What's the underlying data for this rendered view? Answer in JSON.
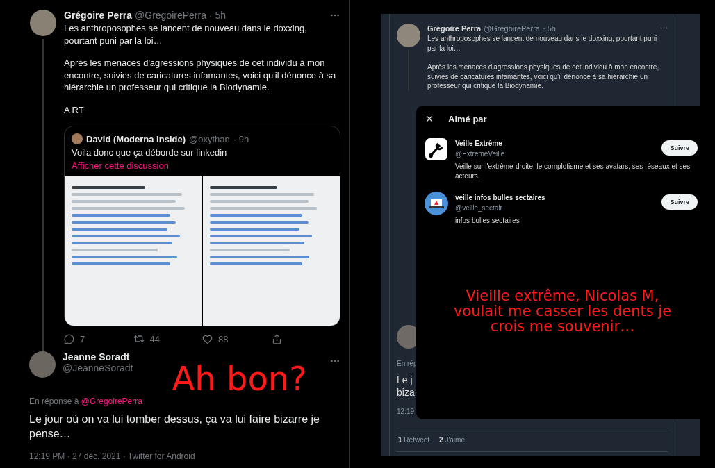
{
  "left_thread": {
    "tweet": {
      "name": "Grégoire Perra",
      "handle": "@GregoirePerra",
      "time": "· 5h",
      "paragraphs": [
        "Les anthroposophes se lancent de nouveau dans le doxxing, pourtant puni par la loi…",
        "Après les menaces d'agressions physiques de cet individu à mon encontre, suivies de caricatures infamantes, voici qu'il dénonce à sa hiérarchie un professeur qui critique la Biodynamie.",
        "A RT"
      ],
      "quote": {
        "name": "David (Moderna inside)",
        "handle": "@oxythan",
        "time": "· 9h",
        "text": "Voila donc que ça déborde sur linkedin",
        "link": "Afficher cette discussion"
      },
      "stats": [
        {
          "kind": "reply",
          "count": "7"
        },
        {
          "kind": "retweet",
          "count": "44"
        },
        {
          "kind": "like",
          "count": "88"
        },
        {
          "kind": "share"
        }
      ]
    },
    "reply": {
      "name": "Jeanne Soradt",
      "handle": "@JeanneSoradt",
      "reply_prefix": "En réponse à",
      "reply_to": "@GregoirePerra",
      "text": "Le jour où on va lui tomber dessus, ça va lui faire bizarre je pense…",
      "meta": "12:19 PM · 27 déc. 2021 · Twitter for Android"
    },
    "annotation": "Ah bon?"
  },
  "right_screenshot": {
    "tweet": {
      "name": "Grégoire Perra",
      "handle": "@GregoirePerra",
      "time": "· 5h",
      "paragraphs": [
        "Les anthroposophes se lancent de nouveau dans le doxxing, pourtant puni par la loi…",
        "Après les menaces d'agressions physiques de cet individu à mon encontre, suivies de caricatures infamantes, voici qu'il dénonce à sa hiérarchie un professeur qui critique la Biodynamie."
      ]
    },
    "reply": {
      "reply_prefix": "En rép",
      "text_lines": [
        "Le j",
        "biza"
      ],
      "meta": "12:19"
    },
    "stats": [
      {
        "count": "1",
        "label": "Retweet"
      },
      {
        "count": "2",
        "label": "J'aime"
      }
    ],
    "modal": {
      "title": "Aimé par",
      "users": [
        {
          "kind": "logo",
          "name": "Veille Extrême",
          "handle": "@ExtremeVeille",
          "bio": "Veille sur l'extrême-droite, le complotisme et ses avatars, ses réseaux et ses acteurs.",
          "button": "Suivre"
        },
        {
          "kind": "laptop",
          "name": "veille infos bulles sectaires",
          "handle": "@veille_sectair",
          "bio": "infos bulles sectaires",
          "button": "Suivre"
        }
      ],
      "annotation": "Vieille extrême, Nicolas M, voulait me casser les dents je crois me souvenir…"
    }
  }
}
